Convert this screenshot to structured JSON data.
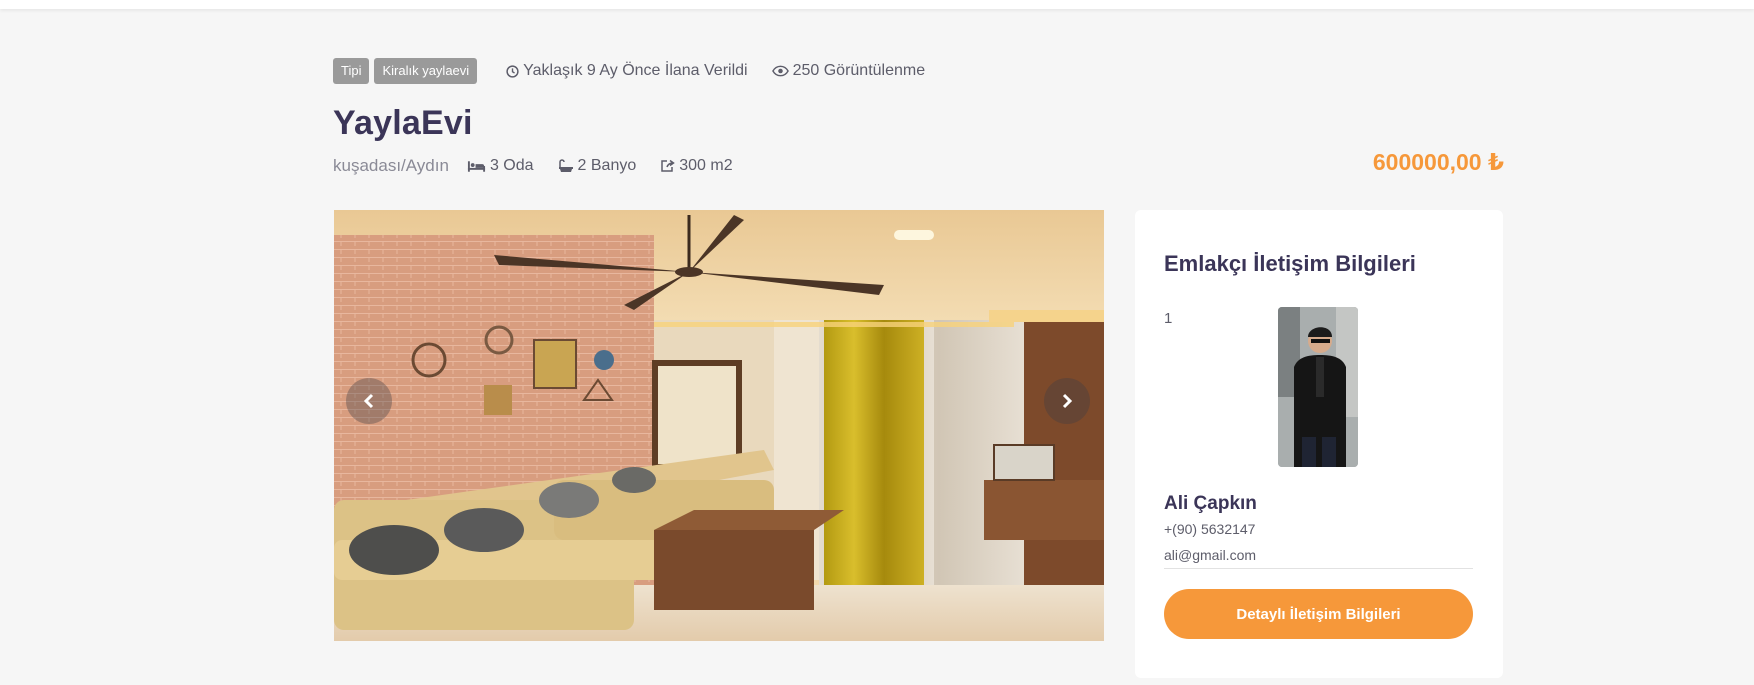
{
  "listing": {
    "tags": [
      "Tipi",
      "Kiralık yaylaevi"
    ],
    "posted": "Yaklaşık 9 Ay Önce İlana Verildi",
    "views": "250 Görüntülenme",
    "title": "YaylaEvi",
    "location": "kuşadası/Aydın",
    "rooms": "3 Oda",
    "bathrooms": "2 Banyo",
    "area": "300 m2",
    "price": "600000,00 ₺"
  },
  "agent_card": {
    "title": "Emlakçı İletişim Bilgileri",
    "index": "1",
    "name": "Ali Çapkın",
    "phone": "+(90) 5632147",
    "email": "ali@gmail.com",
    "button_label": "Detaylı İletişim Bilgileri"
  },
  "icons": {
    "clock": "clock-icon",
    "eye": "eye-icon",
    "bed": "bed-icon",
    "bath": "bath-icon",
    "area": "share-square-icon",
    "prev": "chevron-left-icon",
    "next": "chevron-right-icon"
  },
  "colors": {
    "accent": "#f6983a",
    "heading": "#3b3558",
    "tag_bg": "#9a9a9a",
    "page_bg": "#f6f6f6"
  }
}
